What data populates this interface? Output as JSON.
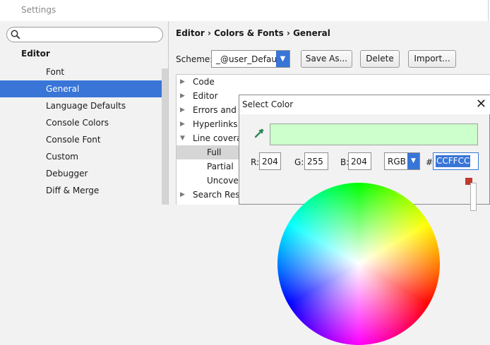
{
  "window": {
    "title": "Settings"
  },
  "sidebar": {
    "search": {
      "value": "",
      "placeholder": ""
    },
    "heading": "Editor",
    "items": [
      {
        "label": "Font"
      },
      {
        "label": "General",
        "selected": true
      },
      {
        "label": "Language Defaults"
      },
      {
        "label": "Console Colors"
      },
      {
        "label": "Console Font"
      },
      {
        "label": "Custom"
      },
      {
        "label": "Debugger"
      },
      {
        "label": "Diff & Merge"
      }
    ]
  },
  "main": {
    "breadcrumb": "Editor › Colors & Fonts › General",
    "scheme_label": "Scheme:",
    "scheme_value": "_@user_Default",
    "buttons": {
      "save_as": "Save As...",
      "delete": "Delete",
      "import": "Import..."
    },
    "tree": [
      {
        "label": "Code",
        "arrow": "▶"
      },
      {
        "label": "Editor",
        "arrow": "▶"
      },
      {
        "label": "Errors and W",
        "arrow": "▶"
      },
      {
        "label": "Hyperlinks",
        "arrow": "▶"
      },
      {
        "label": "Line coverage",
        "arrow": "▼"
      },
      {
        "label": "Full",
        "arrow": ""
      },
      {
        "label": "Partial",
        "arrow": ""
      },
      {
        "label": "Uncover",
        "arrow": ""
      },
      {
        "label": "Search Resul",
        "arrow": "▶"
      }
    ]
  },
  "dialog": {
    "title": "Select Color",
    "close": "✕",
    "r_label": "R:",
    "r_value": "204",
    "g_label": "G:",
    "g_value": "255",
    "b_label": "B:",
    "b_value": "204",
    "mode": "RGB",
    "hash": "#",
    "hex": "CCFFCC",
    "preview_color": "#CCFFCC"
  },
  "colors": {
    "accent": "#3875d7",
    "selection_gray": "#d6d6d6"
  }
}
